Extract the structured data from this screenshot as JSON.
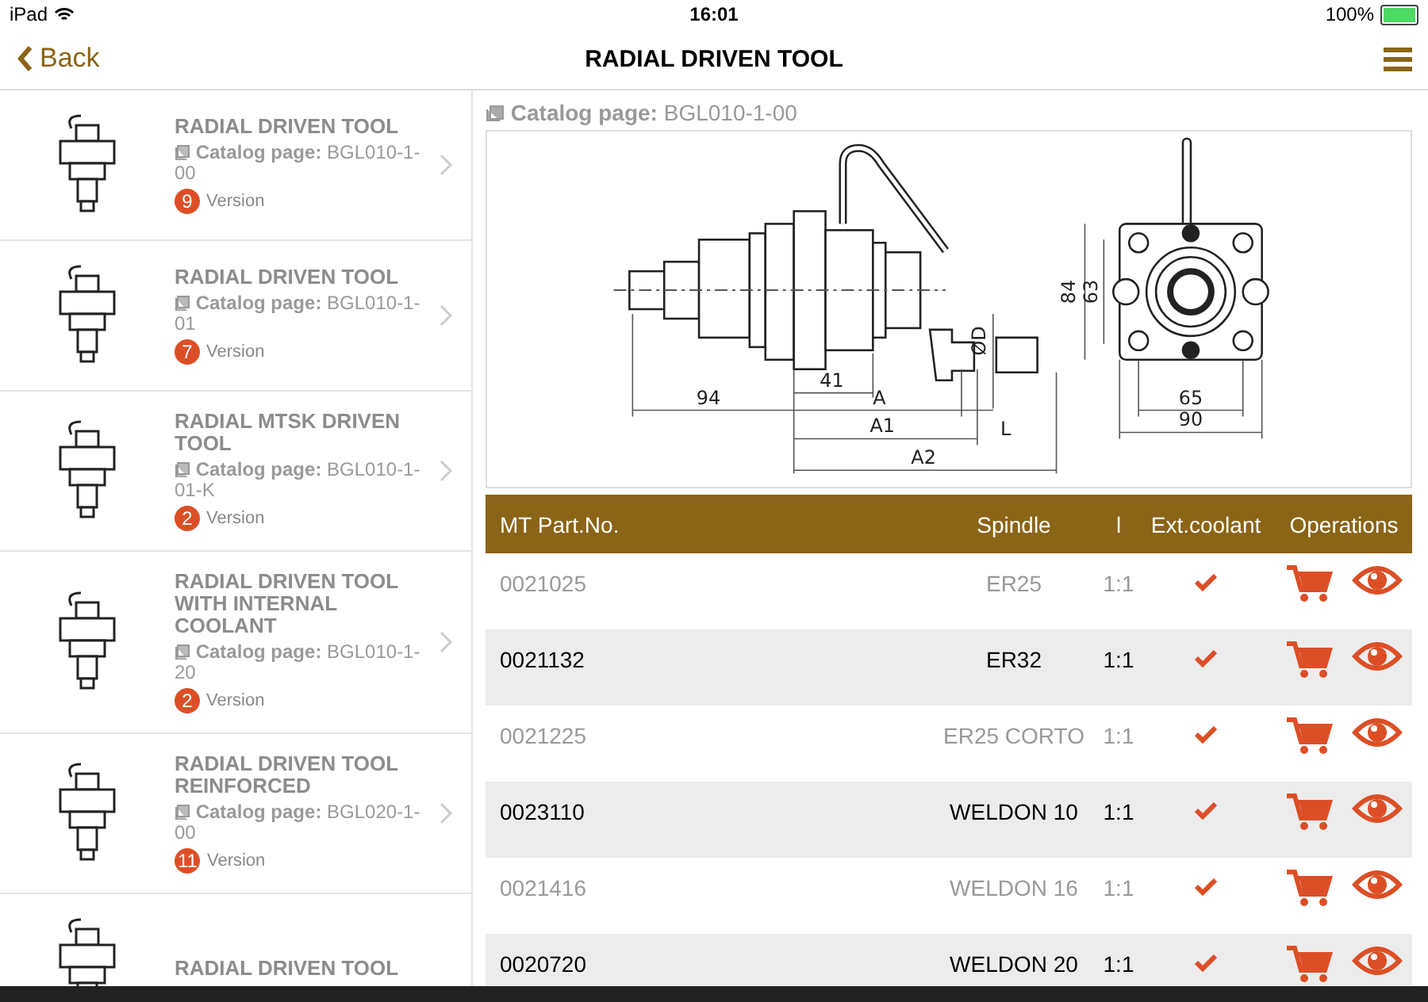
{
  "status_bar": {
    "device": "iPad",
    "time": "16:01",
    "battery": "100%"
  },
  "nav": {
    "back": "Back",
    "title": "RADIAL DRIVEN TOOL"
  },
  "sidebar": {
    "items": [
      {
        "title": "RADIAL DRIVEN TOOL",
        "catalog_label": "Catalog page:",
        "catalog_page": "BGL010-1-00",
        "versions": "9",
        "version_label": "Version"
      },
      {
        "title": "RADIAL DRIVEN TOOL",
        "catalog_label": "Catalog page:",
        "catalog_page": "BGL010-1-01",
        "versions": "7",
        "version_label": "Version"
      },
      {
        "title": "RADIAL MTSK DRIVEN TOOL",
        "catalog_label": "Catalog page:",
        "catalog_page": "BGL010-1-01-K",
        "versions": "2",
        "version_label": "Version"
      },
      {
        "title": "RADIAL DRIVEN TOOL WITH INTERNAL COOLANT",
        "catalog_label": "Catalog page:",
        "catalog_page": "BGL010-1-20",
        "versions": "2",
        "version_label": "Version"
      },
      {
        "title": "RADIAL DRIVEN TOOL REINFORCED",
        "catalog_label": "Catalog page:",
        "catalog_page": "BGL020-1-00",
        "versions": "11",
        "version_label": "Version"
      },
      {
        "title": "RADIAL DRIVEN TOOL"
      }
    ]
  },
  "detail": {
    "catalog_label": "Catalog page:",
    "catalog_page": "BGL010-1-00",
    "drawing_labels": {
      "d94": "94",
      "d41": "41",
      "a": "A",
      "a1": "A1",
      "a2": "A2",
      "l": "L",
      "d": "ØD",
      "d84": "84",
      "d63": "63",
      "d65": "65",
      "d90": "90"
    },
    "table": {
      "columns": [
        "MT Part.No.",
        "Spindle",
        "l",
        "Ext.coolant",
        "Operations"
      ],
      "rows": [
        {
          "part_no": "0021025",
          "spindle": "ER25",
          "l": "1:1",
          "ext_coolant": true,
          "shaded": false
        },
        {
          "part_no": "0021132",
          "spindle": "ER32",
          "l": "1:1",
          "ext_coolant": true,
          "shaded": true
        },
        {
          "part_no": "0021225",
          "spindle": "ER25 CORTO",
          "l": "1:1",
          "ext_coolant": true,
          "shaded": false
        },
        {
          "part_no": "0023110",
          "spindle": "WELDON 10",
          "l": "1:1",
          "ext_coolant": true,
          "shaded": true
        },
        {
          "part_no": "0021416",
          "spindle": "WELDON 16",
          "l": "1:1",
          "ext_coolant": true,
          "shaded": false
        },
        {
          "part_no": "0020720",
          "spindle": "WELDON 20",
          "l": "1:1",
          "ext_coolant": true,
          "shaded": true
        }
      ]
    }
  }
}
